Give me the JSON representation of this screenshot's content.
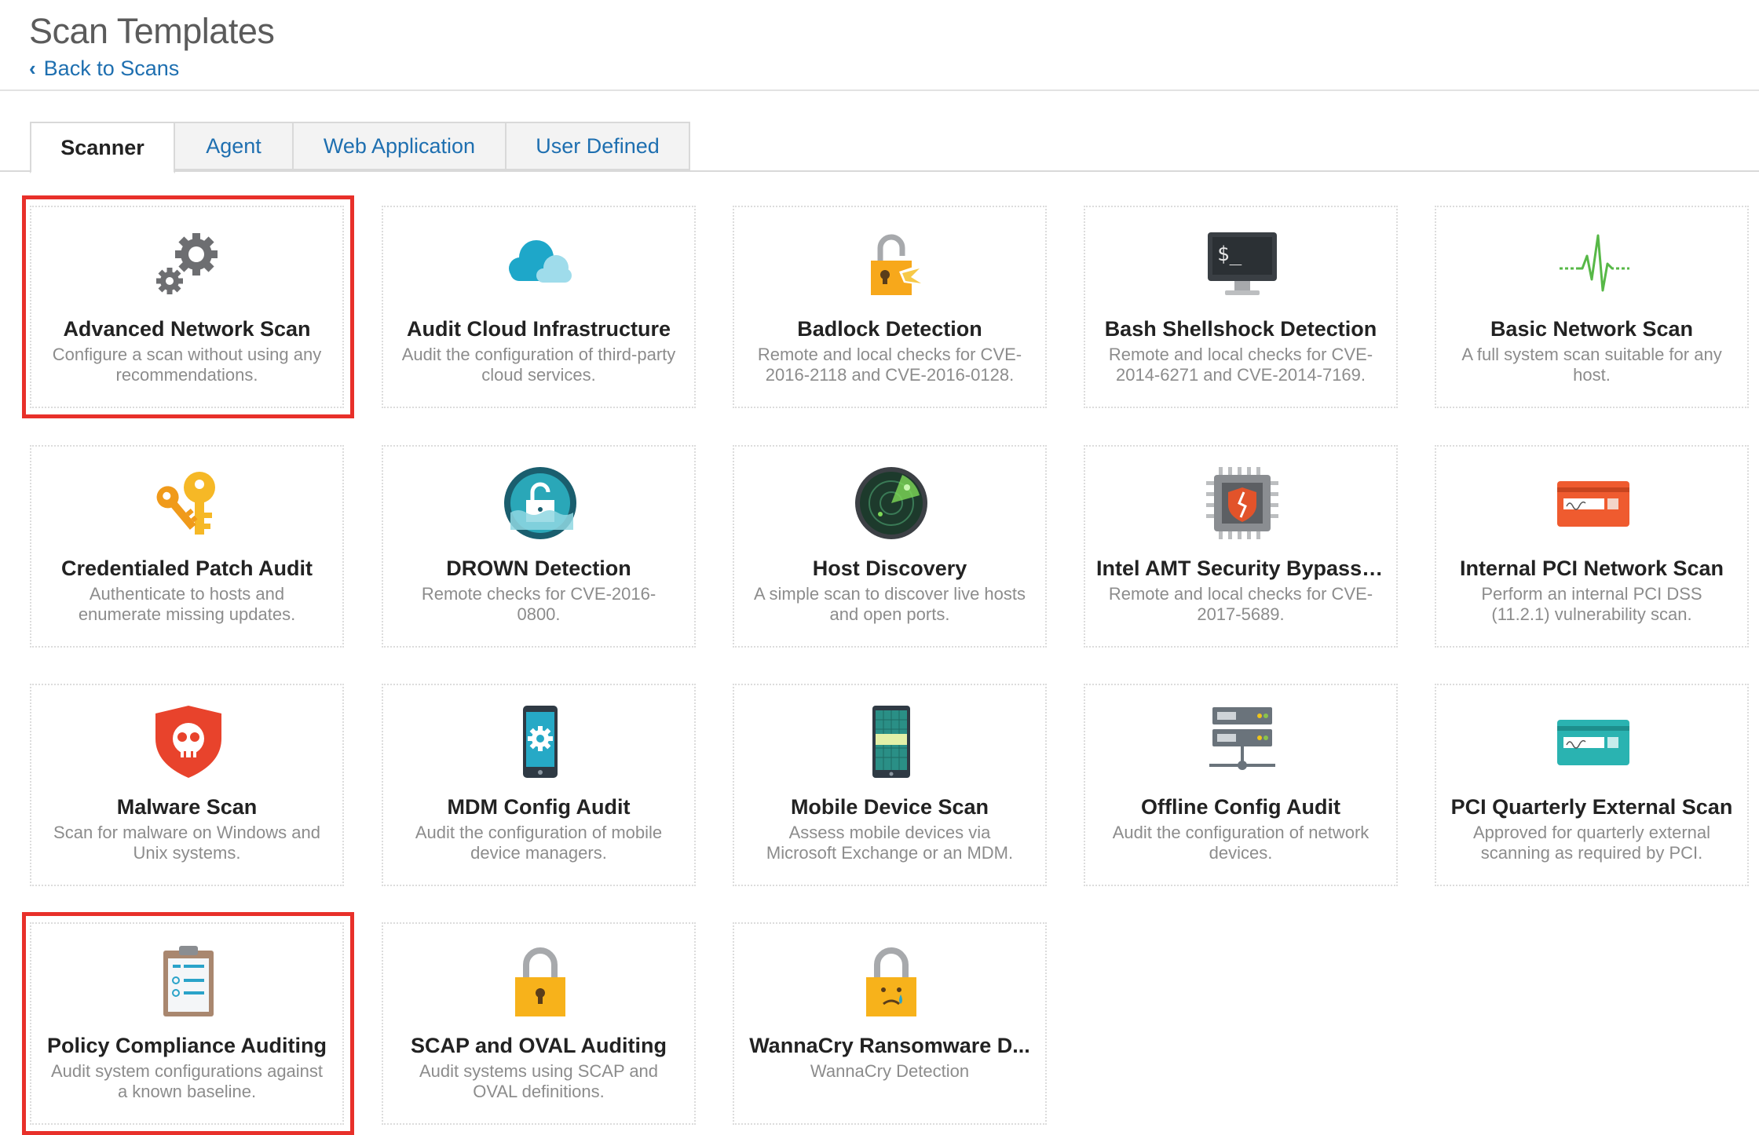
{
  "page": {
    "title": "Scan Templates",
    "back_label": "Back to Scans",
    "back_icon": "chevron-left-icon"
  },
  "tabs": [
    {
      "label": "Scanner",
      "active": true
    },
    {
      "label": "Agent",
      "active": false
    },
    {
      "label": "Web Application",
      "active": false
    },
    {
      "label": "User Defined",
      "active": false
    }
  ],
  "accent_colors": {
    "link": "#1e6fb0",
    "highlight": "#e8302a"
  },
  "templates": [
    {
      "name": "Advanced Network Scan",
      "description": "Configure a scan without using any recommendations.",
      "icon": "gears-icon",
      "highlighted": true
    },
    {
      "name": "Audit Cloud Infrastructure",
      "description": "Audit the configuration of third-party cloud services.",
      "icon": "cloud-icon",
      "highlighted": false
    },
    {
      "name": "Badlock Detection",
      "description": "Remote and local checks for CVE-2016-2118 and CVE-2016-0128.",
      "icon": "broken-lock-icon",
      "highlighted": false
    },
    {
      "name": "Bash Shellshock Detection",
      "description": "Remote and local checks for CVE-2014-6271 and CVE-2014-7169.",
      "icon": "terminal-monitor-icon",
      "highlighted": false
    },
    {
      "name": "Basic Network Scan",
      "description": "A full system scan suitable for any host.",
      "icon": "pulse-icon",
      "highlighted": false
    },
    {
      "name": "Credentialed Patch Audit",
      "description": "Authenticate to hosts and enumerate missing updates.",
      "icon": "keys-icon",
      "highlighted": false
    },
    {
      "name": "DROWN Detection",
      "description": "Remote checks for CVE-2016-0800.",
      "icon": "drown-lock-icon",
      "highlighted": false
    },
    {
      "name": "Host Discovery",
      "description": "A simple scan to discover live hosts and open ports.",
      "icon": "radar-icon",
      "highlighted": false
    },
    {
      "name": "Intel AMT Security Bypass ...",
      "description": "Remote and local checks for CVE-2017-5689.",
      "icon": "chip-shield-icon",
      "highlighted": false
    },
    {
      "name": "Internal PCI Network Scan",
      "description": "Perform an internal PCI DSS (11.2.1) vulnerability scan.",
      "icon": "credit-card-red-icon",
      "highlighted": false
    },
    {
      "name": "Malware Scan",
      "description": "Scan for malware on Windows and Unix systems.",
      "icon": "skull-shield-icon",
      "highlighted": false
    },
    {
      "name": "MDM Config Audit",
      "description": "Audit the configuration of mobile device managers.",
      "icon": "phone-gear-icon",
      "highlighted": false
    },
    {
      "name": "Mobile Device Scan",
      "description": "Assess mobile devices via Microsoft Exchange or an MDM.",
      "icon": "mobile-device-icon",
      "highlighted": false
    },
    {
      "name": "Offline Config Audit",
      "description": "Audit the configuration of network devices.",
      "icon": "server-rack-icon",
      "highlighted": false
    },
    {
      "name": "PCI Quarterly External Scan",
      "description": "Approved for quarterly external scanning as required by PCI.",
      "icon": "credit-card-teal-icon",
      "highlighted": false
    },
    {
      "name": "Policy Compliance Auditing",
      "description": "Audit system configurations against a known baseline.",
      "icon": "clipboard-checklist-icon",
      "highlighted": true
    },
    {
      "name": "SCAP and OVAL Auditing",
      "description": "Audit systems using SCAP and OVAL definitions.",
      "icon": "padlock-icon",
      "highlighted": false
    },
    {
      "name": "WannaCry Ransomware D...",
      "description": "WannaCry Detection",
      "icon": "crying-lock-icon",
      "highlighted": false
    }
  ]
}
